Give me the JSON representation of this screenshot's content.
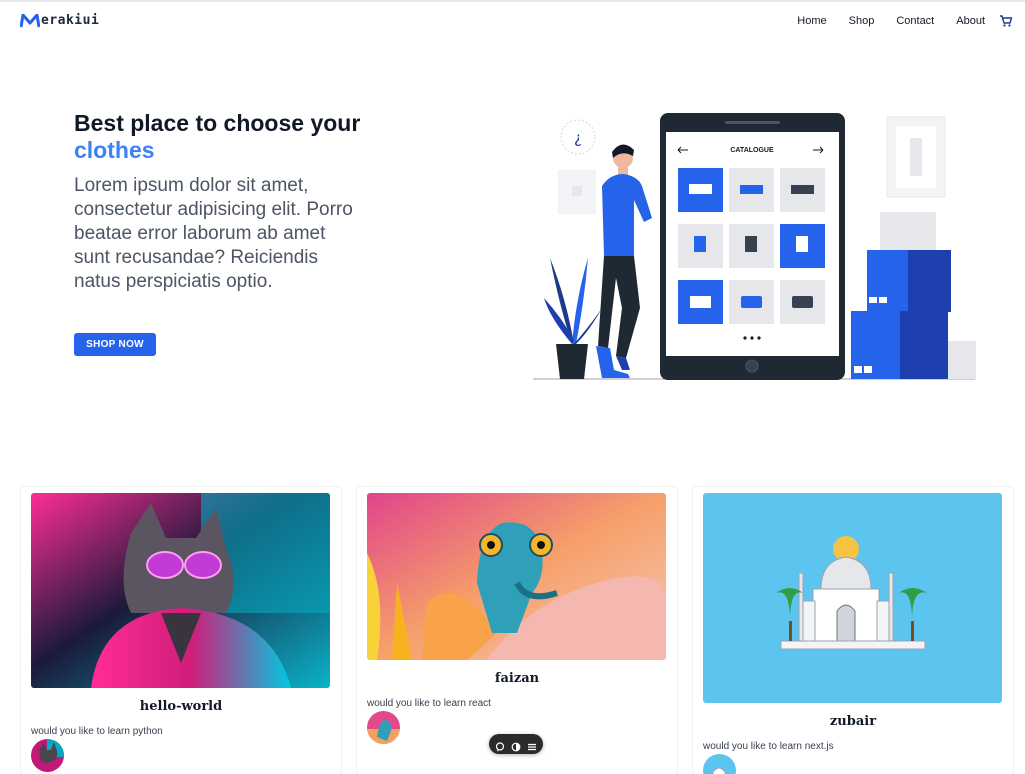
{
  "brand": {
    "name": "erakiui",
    "logo_letter": "M",
    "accent": "#3b82f6"
  },
  "nav": {
    "links": [
      "Home",
      "Shop",
      "Contact",
      "About"
    ],
    "cart_icon": "cart-icon"
  },
  "hero": {
    "title_prefix": "Best place to choose your",
    "title_accent": "clothes",
    "body": "Lorem ipsum dolor sit amet, consectetur adipisicing elit. Porro beatae error laborum ab amet sunt recusandae? Reiciendis natus perspiciatis optio.",
    "cta": "SHOP NOW",
    "illustration": {
      "screen_title": "CATALOGUE",
      "question_mark": "¿"
    }
  },
  "cards": [
    {
      "title": "hello-world",
      "description": "would you like to learn python",
      "image": "cat-with-sunglasses-image"
    },
    {
      "title": "faizan",
      "description": "would you like to learn react",
      "image": "chameleon-image"
    },
    {
      "title": "zubair",
      "description": "would you like to learn next.js",
      "image": "taj-mahal-image"
    }
  ],
  "floating_toolbar": {
    "icons": [
      "chat-icon",
      "theme-icon",
      "menu-icon"
    ]
  }
}
